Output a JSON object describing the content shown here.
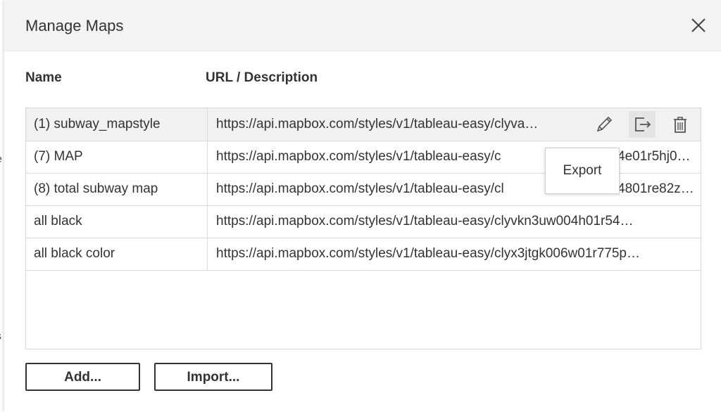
{
  "dialog": {
    "title": "Manage Maps",
    "columns": {
      "name": "Name",
      "url": "URL / Description"
    },
    "rows": [
      {
        "name": "(1) subway_mapstyle",
        "url": "https://api.mapbox.com/styles/v1/tableau-easy/clyva…"
      },
      {
        "name": "(7) MAP",
        "url": "https://api.mapbox.com/styles/v1/tableau-easy/c",
        "url_tail": "4e01r5hj0…"
      },
      {
        "name": "(8) total subway map",
        "url": "https://api.mapbox.com/styles/v1/tableau-easy/cl",
        "url_tail": "4801re82z…"
      },
      {
        "name": "all black",
        "url": "https://api.mapbox.com/styles/v1/tableau-easy/clyvkn3uw004h01r54…"
      },
      {
        "name": "all black color",
        "url": "https://api.mapbox.com/styles/v1/tableau-easy/clyx3jtgk006w01r775p…"
      }
    ],
    "tooltip": "Export",
    "buttons": {
      "add": "Add...",
      "import": "Import..."
    }
  },
  "icons": {
    "close": "close-icon",
    "edit": "pencil-icon",
    "export": "export-icon",
    "delete": "trash-icon"
  },
  "colors": {
    "selected_row": "#f1f1f1",
    "header_bg": "#f3f3f3",
    "hover_action": "#e4e4e4"
  }
}
